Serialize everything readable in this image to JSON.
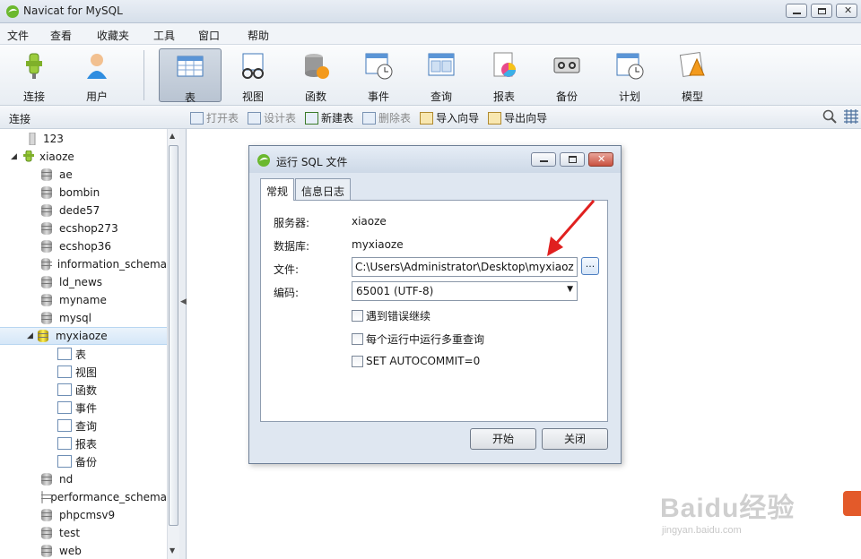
{
  "app": {
    "title": "Navicat for MySQL"
  },
  "menu": [
    "文件",
    "查看",
    "收藏夹",
    "工具",
    "窗口",
    "帮助"
  ],
  "toolbar": [
    {
      "label": "连接",
      "icon": "connection-icon"
    },
    {
      "label": "用户",
      "icon": "user-icon"
    },
    {
      "label": "表",
      "icon": "table-icon"
    },
    {
      "label": "视图",
      "icon": "view-icon"
    },
    {
      "label": "函数",
      "icon": "function-icon"
    },
    {
      "label": "事件",
      "icon": "event-icon"
    },
    {
      "label": "查询",
      "icon": "query-icon"
    },
    {
      "label": "报表",
      "icon": "report-icon"
    },
    {
      "label": "备份",
      "icon": "backup-icon"
    },
    {
      "label": "计划",
      "icon": "schedule-icon"
    },
    {
      "label": "模型",
      "icon": "model-icon"
    }
  ],
  "subbar": {
    "label": "连接",
    "actions": [
      {
        "label": "打开表",
        "enabled": false
      },
      {
        "label": "设计表",
        "enabled": false
      },
      {
        "label": "新建表",
        "enabled": true
      },
      {
        "label": "删除表",
        "enabled": false
      },
      {
        "label": "导入向导",
        "enabled": true
      },
      {
        "label": "导出向导",
        "enabled": true
      }
    ]
  },
  "tree": {
    "items": [
      {
        "label": "123",
        "level": 0,
        "type": "connection"
      },
      {
        "label": "xiaoze",
        "level": 0,
        "type": "connection-open"
      },
      {
        "label": "ae",
        "level": 1,
        "type": "db"
      },
      {
        "label": "bombin",
        "level": 1,
        "type": "db"
      },
      {
        "label": "dede57",
        "level": 1,
        "type": "db"
      },
      {
        "label": "ecshop273",
        "level": 1,
        "type": "db"
      },
      {
        "label": "ecshop36",
        "level": 1,
        "type": "db"
      },
      {
        "label": "information_schema",
        "level": 1,
        "type": "db"
      },
      {
        "label": "ld_news",
        "level": 1,
        "type": "db"
      },
      {
        "label": "myname",
        "level": 1,
        "type": "db"
      },
      {
        "label": "mysql",
        "level": 1,
        "type": "db"
      },
      {
        "label": "myxiaoze",
        "level": 1,
        "type": "db-open",
        "selected": true
      },
      {
        "label": "表",
        "level": 2,
        "type": "table-icon"
      },
      {
        "label": "视图",
        "level": 2,
        "type": "view-icon"
      },
      {
        "label": "函数",
        "level": 2,
        "type": "function-icon"
      },
      {
        "label": "事件",
        "level": 2,
        "type": "event-icon"
      },
      {
        "label": "查询",
        "level": 2,
        "type": "query-icon"
      },
      {
        "label": "报表",
        "level": 2,
        "type": "report-icon"
      },
      {
        "label": "备份",
        "level": 2,
        "type": "backup-icon"
      },
      {
        "label": "nd",
        "level": 1,
        "type": "db"
      },
      {
        "label": "performance_schema",
        "level": 1,
        "type": "db"
      },
      {
        "label": "phpcmsv9",
        "level": 1,
        "type": "db"
      },
      {
        "label": "test",
        "level": 1,
        "type": "db"
      },
      {
        "label": "web",
        "level": 1,
        "type": "db"
      }
    ]
  },
  "dialog": {
    "title": "运行 SQL 文件",
    "tabs": [
      "常规",
      "信息日志"
    ],
    "server_label": "服务器:",
    "server_value": "xiaoze",
    "database_label": "数据库:",
    "database_value": "myxiaoze",
    "file_label": "文件:",
    "file_value": "C:\\Users\\Administrator\\Desktop\\myxiaoze",
    "browse_label": "...",
    "encoding_label": "编码:",
    "encoding_value": "65001 (UTF-8)",
    "checkboxes": [
      "遇到错误继续",
      "每个运行中运行多重查询",
      "SET AUTOCOMMIT=0"
    ],
    "start_label": "开始",
    "close_label": "关闭"
  },
  "watermark": {
    "main": "Baidu经验",
    "sub": "jingyan.baidu.com"
  },
  "colors": {
    "arrow": "#e0201f",
    "selection": "#d5e7f8"
  }
}
